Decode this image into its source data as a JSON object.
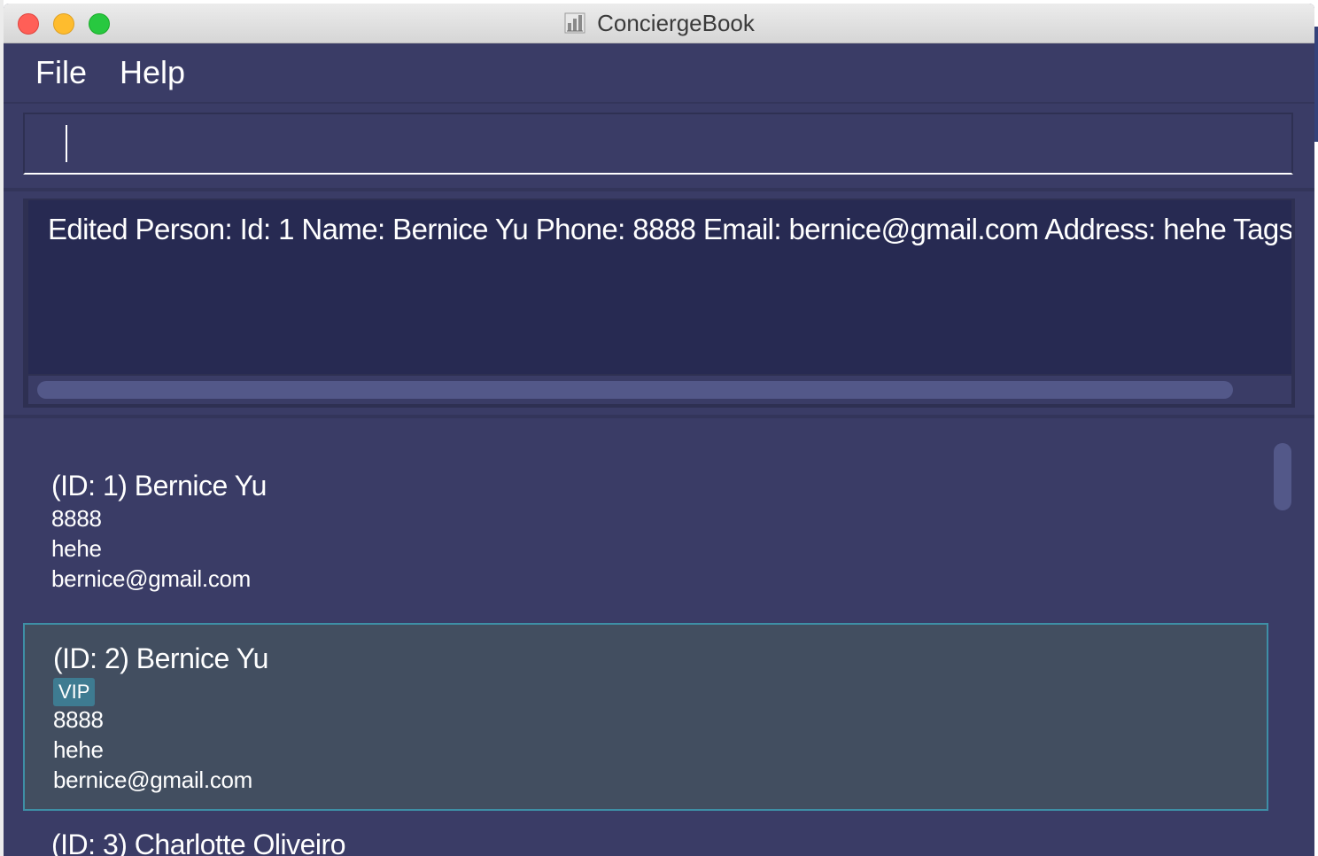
{
  "window": {
    "title": "ConciergeBook"
  },
  "menu": {
    "file": "File",
    "help": "Help"
  },
  "command": {
    "value": "",
    "placeholder": ""
  },
  "result": {
    "text": "Edited Person: Id: 1 Name: Bernice Yu Phone: 8888 Email: bernice@gmail.com Address: hehe Tags: [VIP]"
  },
  "persons": [
    {
      "header": "(ID: 1) Bernice Yu",
      "phone": "8888",
      "address": "hehe",
      "email": "bernice@gmail.com"
    },
    {
      "header": "(ID: 2) Bernice Yu",
      "tag": "VIP",
      "phone": "8888",
      "address": "hehe",
      "email": "bernice@gmail.com"
    },
    {
      "header": "(ID: 3) Charlotte Oliveiro"
    }
  ],
  "icons": {
    "app": "building-icon"
  },
  "colors": {
    "background": "#3a3c66",
    "result_background": "#272a52",
    "selected_card": "#424e60",
    "selected_border": "#3e8fa6",
    "tag": "#3e7b91"
  }
}
